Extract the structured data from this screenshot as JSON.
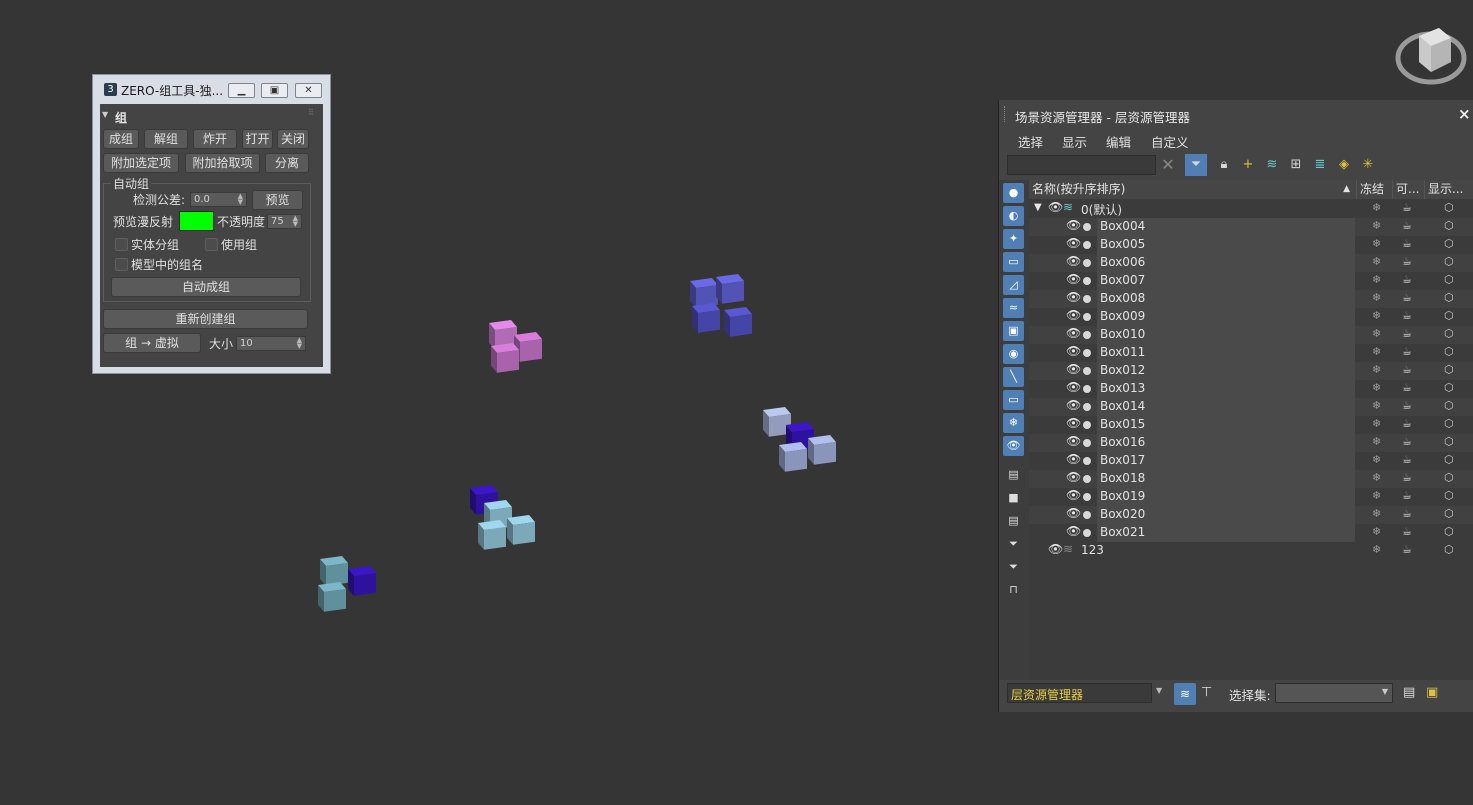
{
  "tool_window": {
    "title": "ZERO-组工具-独...",
    "app_glyph": "3",
    "rollout_title": "组",
    "row1": [
      "成组",
      "解组",
      "炸开",
      "打开",
      "关闭"
    ],
    "row2": [
      "附加选定项",
      "附加拾取项",
      "分离"
    ],
    "auto_group": {
      "title": "自动组",
      "tolerance_label": "检测公差:",
      "tolerance_value": "0.0",
      "preview_button": "预览",
      "preview_diffuse_label": "预览漫反射",
      "preview_color": "#00ff00",
      "opacity_label": "不透明度",
      "opacity_value": "75",
      "check_solid": "实体分组",
      "check_use_group": "使用组",
      "check_model_name": "模型中的组名",
      "auto_button": "自动成组"
    },
    "recreate_button": "重新创建组",
    "to_dummy_button": "组 → 虚拟",
    "size_label": "大小",
    "size_value": "10"
  },
  "explorer": {
    "title": "场景资源管理器 - 层资源管理器",
    "menu": [
      "选择",
      "显示",
      "编辑",
      "自定义"
    ],
    "columns": {
      "name": "名称(按升序排序)",
      "sort_indicator": "▲",
      "freeze": "冻结",
      "render": "可...",
      "display": "显示..."
    },
    "layer_default": "0(默认)",
    "objects": [
      "Box004",
      "Box005",
      "Box006",
      "Box007",
      "Box008",
      "Box009",
      "Box010",
      "Box011",
      "Box012",
      "Box013",
      "Box014",
      "Box015",
      "Box016",
      "Box017",
      "Box018",
      "Box019",
      "Box020",
      "Box021"
    ],
    "layer_other": "123",
    "bottom_combo_value": "层资源管理器",
    "selection_set_label": "选择集:",
    "selection_set_value": ""
  },
  "colors": {
    "viewport_bg": "#353535",
    "accent_blue": "#4f7fb5",
    "bottom_combo_text": "#e8d040"
  },
  "icons": {
    "eye": "👁",
    "freeze": "❄",
    "teapot": "teapot-icon",
    "box": "box-icon"
  }
}
